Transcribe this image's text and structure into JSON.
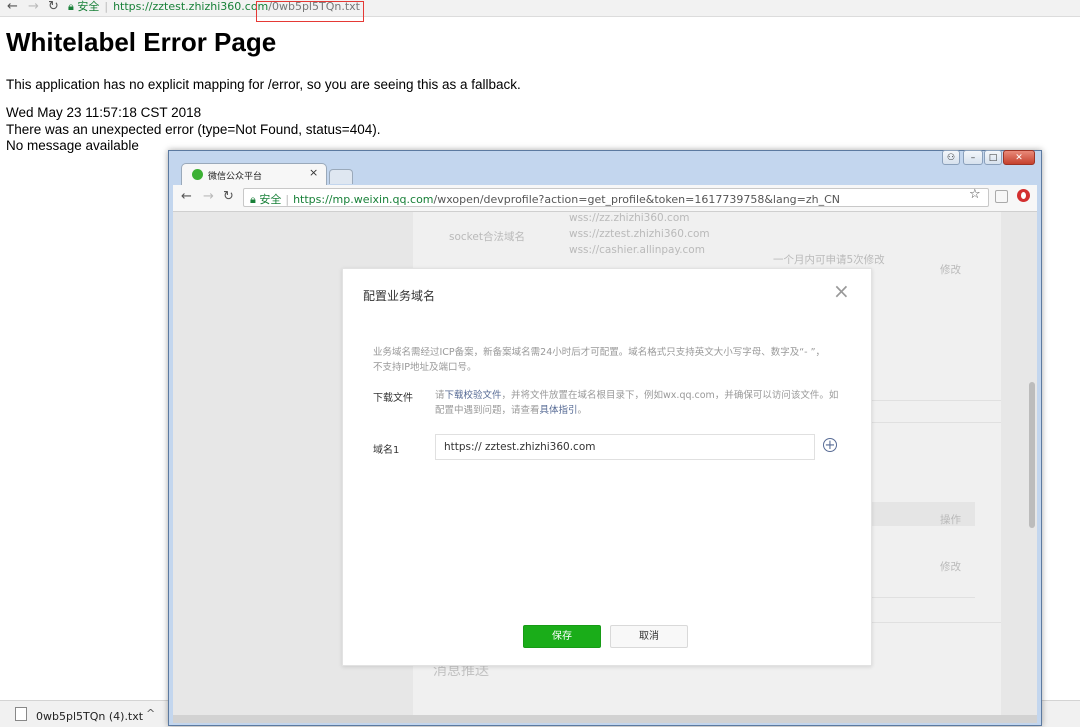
{
  "outer_browser": {
    "secure_label": "安全",
    "url_host": "https://zztest.zhizhi360.com",
    "url_path": "/0wb5pl5TQn.txt",
    "highlight_color": "#e53935"
  },
  "error_page": {
    "title": "Whitelabel Error Page",
    "line1": "This application has no explicit mapping for /error, so you are seeing this as a fallback.",
    "line2": "Wed May 23 11:57:18 CST 2018",
    "line3": "There was an unexpected error (type=Not Found, status=404).",
    "line4": "No message available"
  },
  "download_bar": {
    "file_name": "0wb5pl5TQn (4).txt",
    "chevron": "^"
  },
  "inner_browser": {
    "tab_title": "微信公众平台",
    "tab_close": "×",
    "secure_label": "安全",
    "url_host": "https://mp.weixin.qq.com",
    "url_path": "/wxopen/devprofile?action=get_profile&token=1617739758&lang=zh_CN",
    "window_controls": {
      "minimize": "–",
      "maximize": "□",
      "close": "✕"
    }
  },
  "background_page": {
    "socket_label": "socket合法域名",
    "socket_domains": [
      "wss://zz.zhizhi360.com",
      "wss://zztest.zhizhi360.com",
      "wss://cashier.allinpay.com"
    ],
    "modify_notice": "一个月内可申请5次修改",
    "modify_link_1": "修改",
    "operation_header": "操作",
    "modify_link_2": "修改",
    "section_title": "消息推送"
  },
  "dialog": {
    "title": "配置业务域名",
    "close_icon": "×",
    "description": "业务域名需经过ICP备案，新备案域名需24小时后才可配置。域名格式只支持英文大小写字母、数字及“- ”，不支持IP地址及端口号。",
    "download_label": "下载文件",
    "download_text_pre": "请",
    "download_link": "下载校验文件",
    "download_text_mid": "，并将文件放置在域名根目录下，例如wx.qq.com，并确保可以访问该文件。如配置中遇到问题，请查看",
    "guide_link": "具体指引",
    "download_text_end": "。",
    "domain_label": "域名1",
    "domain_value": "https:// zztest.zhizhi360.com",
    "add_icon": "+",
    "save_label": "保存",
    "cancel_label": "取消",
    "accent_color": "#1aad19"
  }
}
